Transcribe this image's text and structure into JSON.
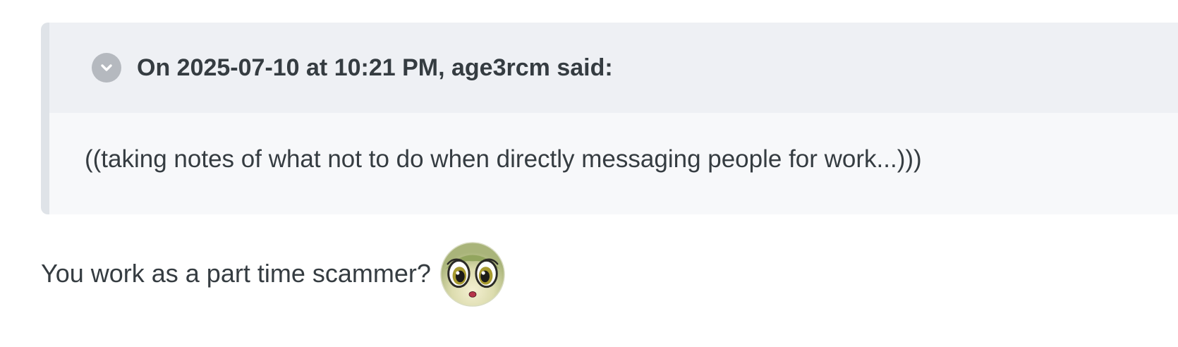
{
  "quote": {
    "citation": "On 2025-07-10 at 10:21 PM, age3rcm said:",
    "toggle_icon": "chevron-down-icon",
    "body": "((taking notes of what not to do when directly messaging people for work...)))"
  },
  "reply": {
    "text": "You work as a part time scammer?",
    "emoji_icon": "surprised-pony-face-emoji"
  },
  "colors": {
    "quote_header_bg": "#eef0f4",
    "quote_body_bg": "#f7f8fa",
    "quote_border": "#dfe3e8",
    "toggle_bg": "#b5b9bf",
    "text": "#353c41"
  }
}
